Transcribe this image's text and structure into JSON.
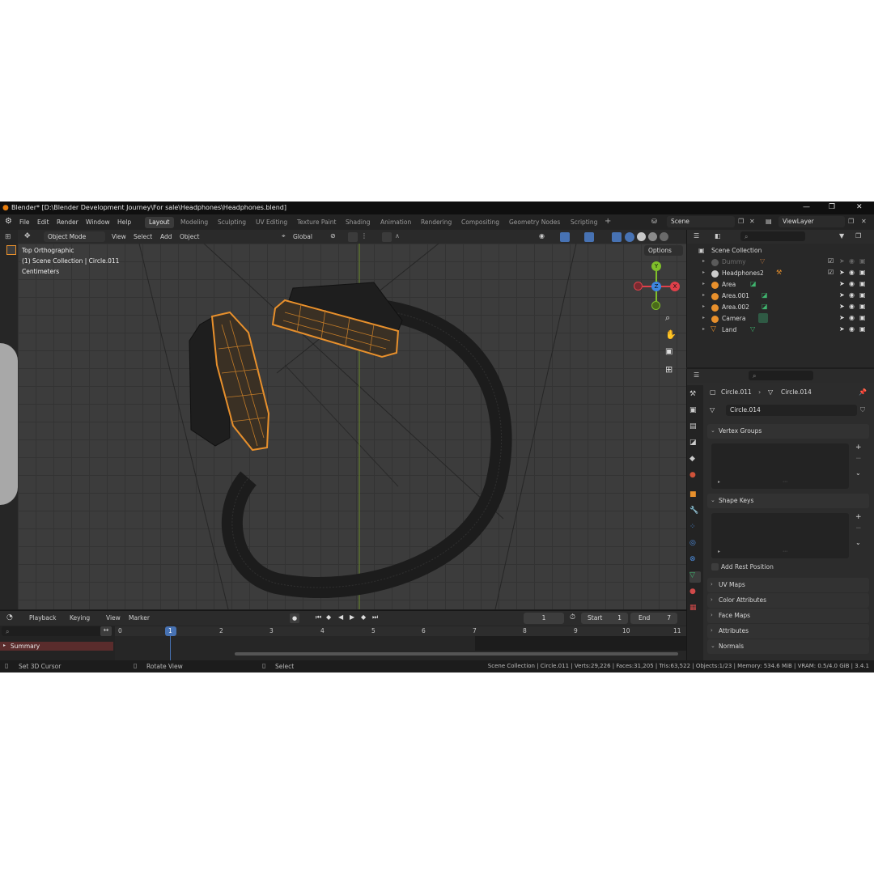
{
  "window": {
    "title": "Blender* [D:\\Blender Development Journey\\For sale\\Headphones\\Headphones.blend]"
  },
  "menus": [
    "File",
    "Edit",
    "Render",
    "Window",
    "Help"
  ],
  "workspaces": [
    "Layout",
    "Modeling",
    "Sculpting",
    "UV Editing",
    "Texture Paint",
    "Shading",
    "Animation",
    "Rendering",
    "Compositing",
    "Geometry Nodes",
    "Scripting"
  ],
  "scene": {
    "name": "Scene",
    "view_layer": "ViewLayer"
  },
  "viewport_header": {
    "mode": "Object Mode",
    "menus": [
      "View",
      "Select",
      "Add",
      "Object"
    ],
    "transform_orientation": "Global",
    "options": "Options"
  },
  "viewport": {
    "view_name": "Top Orthographic",
    "collection_info": "(1) Scene Collection | Circle.011",
    "units": "Centimeters",
    "gizmo": {
      "y": "Y",
      "x": "X",
      "z": "Z"
    }
  },
  "outliner": {
    "root": "Scene Collection",
    "items": [
      {
        "label": "Dummy",
        "dim": true
      },
      {
        "label": "Headphones2",
        "dim": false
      },
      {
        "label": "Area",
        "dim": false
      },
      {
        "label": "Area.001",
        "dim": false
      },
      {
        "label": "Area.002",
        "dim": false
      },
      {
        "label": "Camera",
        "dim": false
      },
      {
        "label": "Land",
        "dim": false
      }
    ]
  },
  "properties": {
    "breadcrumb_object": "Circle.011",
    "breadcrumb_data": "Circle.014",
    "datablock_name": "Circle.014",
    "panels": {
      "vertex_groups": "Vertex Groups",
      "shape_keys": "Shape Keys",
      "add_rest_position": "Add Rest Position",
      "uv_maps": "UV Maps",
      "color_attributes": "Color Attributes",
      "face_maps": "Face Maps",
      "attributes": "Attributes",
      "normals": "Normals"
    }
  },
  "timeline": {
    "menus": [
      "Playback",
      "Keying",
      "View",
      "Marker"
    ],
    "current_frame": "1",
    "start_label": "Start",
    "start_value": "1",
    "end_label": "End",
    "end_value": "7",
    "frame_numbers": [
      "0",
      "1",
      "2",
      "3",
      "4",
      "5",
      "6",
      "7",
      "8",
      "9",
      "10",
      "11"
    ],
    "summary": "Summary"
  },
  "status": {
    "left": "Set 3D Cursor",
    "middle": "Rotate View",
    "right": "Select",
    "info": "Scene Collection | Circle.011 | Verts:29,226 | Faces:31,205 | Tris:63,522 | Objects:1/23 | Memory: 534.6 MiB | VRAM: 0.5/4.0 GiB | 3.4.1"
  },
  "colors": {
    "selected_outline": "#e8902c",
    "active_tab": "#4772b3",
    "axis_x": "#e0404a",
    "axis_y": "#7fbf2a",
    "axis_z": "#3d86e0"
  }
}
